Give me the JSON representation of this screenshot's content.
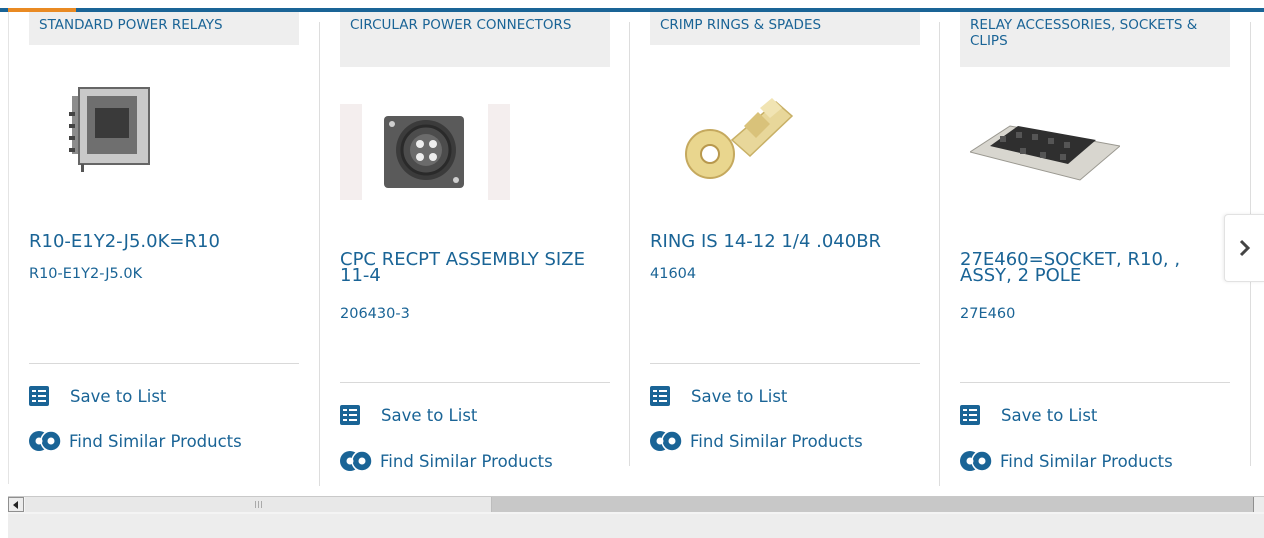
{
  "cards": [
    {
      "category": "STANDARD POWER RELAYS",
      "title": "R10-E1Y2-J5.0K=R10",
      "part_number": "R10-E1Y2-J5.0K",
      "image": "relay-image",
      "save_label": "Save to List",
      "similar_label": "Find Similar Products"
    },
    {
      "category": "CIRCULAR POWER CONNECTORS",
      "title": "CPC RECPT ASSEMBLY SIZE 11-4",
      "part_number": "206430-3",
      "image": "connector-image",
      "save_label": "Save to List",
      "similar_label": "Find Similar Products"
    },
    {
      "category": "CRIMP RINGS & SPADES",
      "title": "RING IS 14-12 1/4 .040BR",
      "part_number": "41604",
      "image": "ring-terminal-image",
      "save_label": "Save to List",
      "similar_label": "Find Similar Products"
    },
    {
      "category": "RELAY ACCESSORIES, SOCKETS & CLIPS",
      "title": "27E460=SOCKET, R10, , ASSY, 2 POLE",
      "part_number": "27E460",
      "image": "socket-image",
      "save_label": "Save to List",
      "similar_label": "Find Similar Products"
    }
  ],
  "carousel": {
    "next_icon": "chevron-right-icon"
  },
  "colors": {
    "accent": "#1a6496",
    "highlight": "#e98a23"
  }
}
